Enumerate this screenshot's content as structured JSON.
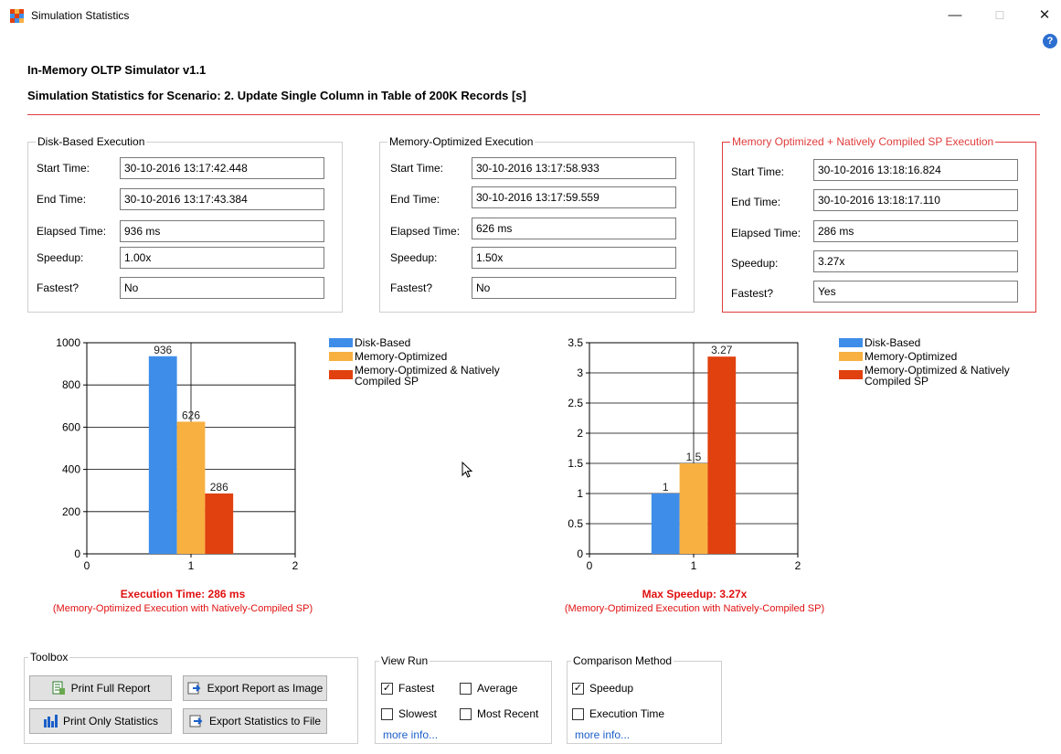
{
  "window": {
    "title": "Simulation Statistics",
    "minimize": "—",
    "maximize": "☐",
    "close": "✕",
    "help": "?"
  },
  "header": {
    "app_version": "In-Memory OLTP Simulator v1.1",
    "scenario_title": "Simulation Statistics for Scenario: 2. Update Single Column in Table of 200K Records [s]"
  },
  "labels": {
    "start_time": "Start Time:",
    "end_time": "End Time:",
    "elapsed_time": "Elapsed Time:",
    "speedup": "Speedup:",
    "fastest": "Fastest?"
  },
  "groups": [
    {
      "title": "Disk-Based Execution",
      "start_time": "30-10-2016 13:17:42.448",
      "end_time": "30-10-2016 13:17:43.384",
      "elapsed_time": "936 ms",
      "speedup": "1.00x",
      "fastest": "No"
    },
    {
      "title": "Memory-Optimized Execution",
      "start_time": "30-10-2016 13:17:58.933",
      "end_time": "30-10-2016 13:17:59.559",
      "elapsed_time": "626 ms",
      "speedup": "1.50x",
      "fastest": "No"
    },
    {
      "title": "Memory Optimized + Natively Compiled  SP Execution",
      "start_time": "30-10-2016 13:18:16.824",
      "end_time": "30-10-2016 13:18:17.110",
      "elapsed_time": "286 ms",
      "speedup": "3.27x",
      "fastest": "Yes"
    }
  ],
  "colors": {
    "disk": "#3e8ee9",
    "memory": "#f8b041",
    "native": "#e0410e",
    "accent_red": "#e03c3c"
  },
  "legend": [
    "Disk-Based",
    "Memory-Optimized",
    "Memory-Optimized & Natively Compiled SP"
  ],
  "chart_data": [
    {
      "type": "bar",
      "x_ticks": [
        "0",
        "1",
        "2"
      ],
      "y_ticks": [
        "0",
        "200",
        "400",
        "600",
        "800",
        "1000"
      ],
      "ylim": [
        0,
        1000
      ],
      "xlim": [
        0,
        2
      ],
      "series": [
        {
          "name": "Disk-Based",
          "value": 936,
          "label": "936"
        },
        {
          "name": "Memory-Optimized",
          "value": 626,
          "label": "626"
        },
        {
          "name": "Memory-Optimized & Natively Compiled SP",
          "value": 286,
          "label": "286"
        }
      ],
      "caption": "Execution Time: 286 ms",
      "subcaption": "(Memory-Optimized Execution with Natively-Compiled SP)"
    },
    {
      "type": "bar",
      "x_ticks": [
        "0",
        "1",
        "2"
      ],
      "y_ticks": [
        "0",
        "0.5",
        "1",
        "1.5",
        "2",
        "2.5",
        "3",
        "3.5"
      ],
      "ylim": [
        0,
        3.5
      ],
      "xlim": [
        0,
        2
      ],
      "series": [
        {
          "name": "Disk-Based",
          "value": 1,
          "label": "1"
        },
        {
          "name": "Memory-Optimized",
          "value": 1.5,
          "label": "1.5"
        },
        {
          "name": "Memory-Optimized & Natively Compiled SP",
          "value": 3.27,
          "label": "3.27"
        }
      ],
      "caption": "Max Speedup: 3.27x",
      "subcaption": "(Memory-Optimized Execution with Natively-Compiled SP)"
    }
  ],
  "toolbox": {
    "title": "Toolbox",
    "print_full": "Print Full Report",
    "export_image": "Export Report as Image",
    "print_stats": "Print Only Statistics",
    "export_stats": "Export Statistics to File"
  },
  "view_run": {
    "title": "View Run",
    "fastest": "Fastest",
    "fastest_checked": "✓",
    "average": "Average",
    "slowest": "Slowest",
    "most_recent": "Most Recent",
    "more_info": "more info..."
  },
  "comparison": {
    "title": "Comparison Method",
    "speedup": "Speedup",
    "speedup_checked": "✓",
    "execution_time": "Execution Time",
    "more_info": "more info..."
  }
}
